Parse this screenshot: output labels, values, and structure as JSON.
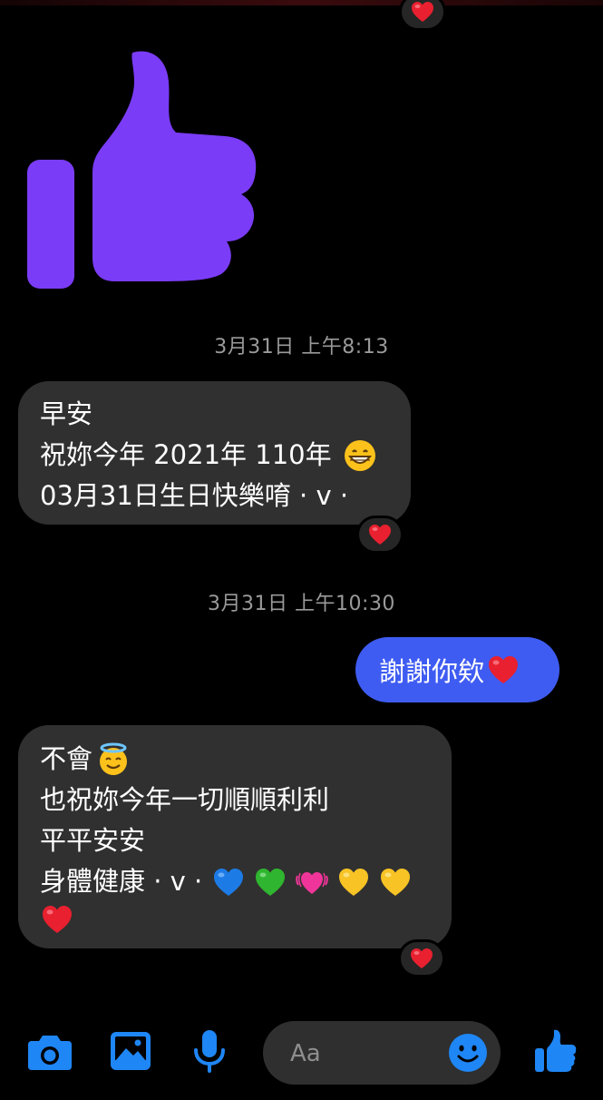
{
  "colors": {
    "accent": "#3f5cf2",
    "thumb": "#7b3cf7",
    "incoming_bubble": "#303030",
    "heart": "#e8202f"
  },
  "messages": {
    "thumb_reaction": "heart",
    "timestamp_1": "3月31日 上午8:13",
    "msg1": {
      "line1": "早安",
      "line2": "祝妳今年 2021年 110年",
      "line2_emoji": "grinning-face",
      "line3": "03月31日生日快樂唷 · v ·",
      "reaction": "heart"
    },
    "timestamp_2": "3月31日 上午10:30",
    "msg2": {
      "text": "謝謝你欸",
      "emoji": "red-heart"
    },
    "msg3": {
      "line1": "不會",
      "line1_emoji": "smiling-face-with-halo",
      "line2": "也祝妳今年一切順順利利",
      "line3": "平平安安",
      "line4": "身體健康 · v ·",
      "line4_emojis": [
        "blue-heart",
        "green-heart",
        "beating-heart",
        "yellow-heart",
        "yellow-heart"
      ],
      "line5_emoji": "red-heart",
      "reaction": "heart"
    }
  },
  "composer": {
    "placeholder": "Aa",
    "icons": [
      "camera-icon",
      "image-icon",
      "microphone-icon",
      "emoji-icon",
      "thumbs-up-icon"
    ]
  }
}
